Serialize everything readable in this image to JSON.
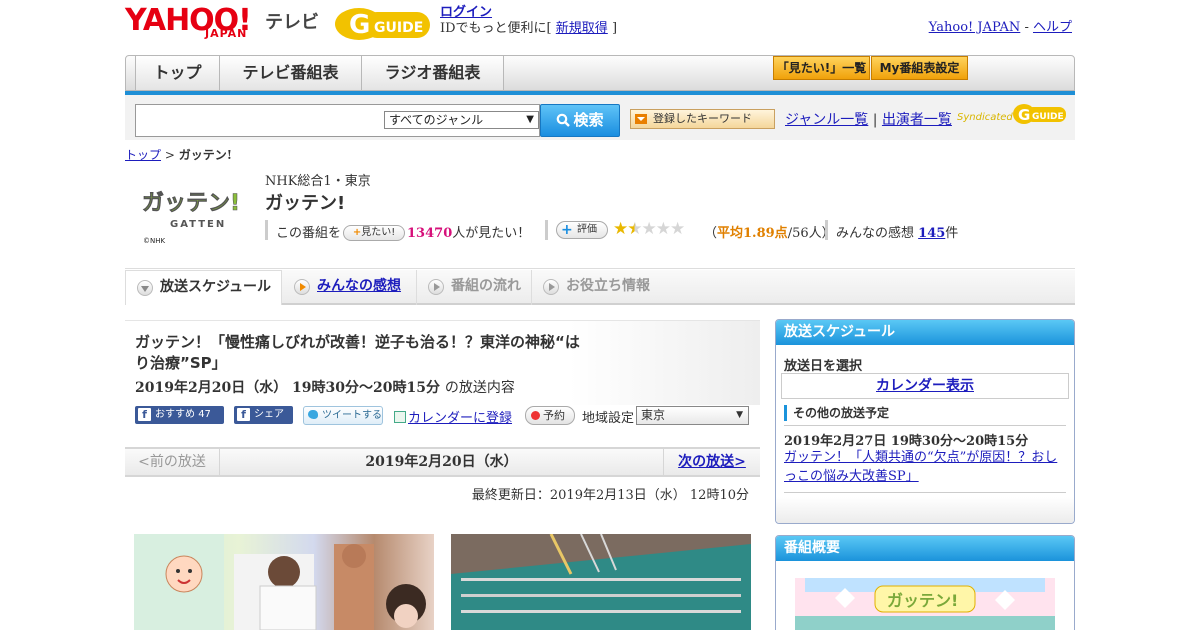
{
  "header": {
    "yahoo_logo": "YAHOO!",
    "yahoo_sub": "JAPAN",
    "tv_label": "テレビ",
    "gguide_logo": "G GUIDE",
    "login": "ログイン",
    "login_note_prefix": "IDでもっと便利に[",
    "signup": "新規取得",
    "login_note_suffix": "]",
    "yahoo_japan": "Yahoo! JAPAN",
    "separator": "-",
    "help": "ヘルプ"
  },
  "nav": {
    "tabs": [
      "トップ",
      "テレビ番組表",
      "ラジオ番組表"
    ],
    "mitai_list": "「見たい!」一覧",
    "my_bangumi": "My番組表設定"
  },
  "search": {
    "placeholder": "",
    "genre": "すべてのジャンル",
    "button": "検索",
    "keyword_button": "登録したキーワード",
    "genre_list": "ジャンル一覧",
    "link_sep": "|",
    "performer_list": "出演者一覧",
    "syndicated": "Syndicated"
  },
  "breadcrumb": {
    "top": "トップ",
    "sep": ">",
    "current": "ガッテン!"
  },
  "program": {
    "logo_text": "ガッテン!",
    "logo_sub": "GATTEN",
    "logo_caption": "©NHK",
    "channel": "NHK総合1・東京",
    "title": "ガッテン!",
    "mitai_prefix": "この番組を",
    "mitai_chip": "見たい!",
    "mitai_count": "13470",
    "mitai_suffix": "人が見たい！",
    "hyoka_chip": "評価",
    "rating": 1.89,
    "rating_open": "（",
    "rating_avg": "平均1.89点",
    "rating_count": "/56人）",
    "kanso_prefix": "みんなの感想",
    "kanso_count": "145",
    "kanso_suffix": "件"
  },
  "tabs": [
    "放送スケジュール",
    "みんなの感想",
    "番組の流れ",
    "お役立ち情報"
  ],
  "episode": {
    "title": "ガッテン！「慢性痛しびれが改善！逆子も治る！？東洋の神秘“はり治療”SP」",
    "date": "2019年2月20日（水） 19時30分～20時15分",
    "date_suffix": "の放送内容",
    "recommend": "おすすめ",
    "recommend_count": "47",
    "share": "シェア",
    "tweet": "ツイートする",
    "calendar_register": "カレンダーに登録",
    "yoyaku": "予約",
    "region_label": "地域設定",
    "region": "東京"
  },
  "pager": {
    "prev": "<前の放送",
    "date": "2019年2月20日（水）",
    "next": "次の放送>"
  },
  "updated": "最終更新日：2019年2月13日（水） 12時10分",
  "sidebar": {
    "schedule_title": "放送スケジュール",
    "select_day": "放送日を選択",
    "calendar_link": "カレンダー表示",
    "other_head": "その他の放送予定",
    "other_date": "2019年2月27日 19時30分～20時15分",
    "other_link": "ガッテン！「人類共通の“欠点”が原因！？おしっこの悩み大改善SP」",
    "overview_title": "番組概要"
  },
  "colors": {
    "yahoo_red": "#e60012",
    "link_blue": "#1d1dbd",
    "accent_blue": "#1b93db",
    "orange": "#f0a10a",
    "pink_count": "#d6107a"
  }
}
